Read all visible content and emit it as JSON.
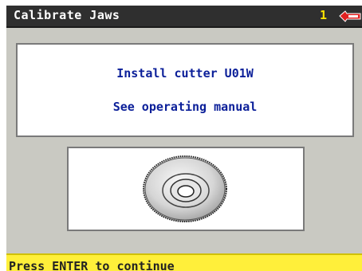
{
  "header": {
    "title": "Calibrate Jaws",
    "step": "1",
    "logo_icon": "key-brand-logo-icon"
  },
  "message": {
    "line1": "Install cutter U01W",
    "line2": "See operating manual"
  },
  "illustration": {
    "icon": "cutter-wheel-icon"
  },
  "status": {
    "text": "Press ENTER to continue"
  },
  "colors": {
    "title_bg": "#2f2f2f",
    "step_color": "#ffe400",
    "message_text": "#0b1f99",
    "status_bg": "#ffef3a",
    "workarea_bg": "#c9c9c2"
  }
}
